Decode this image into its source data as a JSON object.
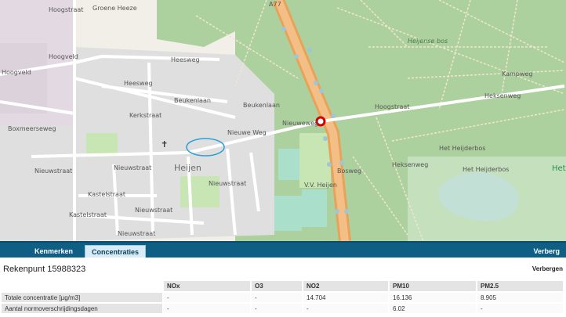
{
  "map": {
    "labels": {
      "hoogveld": "Hoogveld",
      "hoogveld2": "Hoogveld",
      "hoogstraat": "Hoogstraat",
      "groeneheeze": "Groene Heeze",
      "heesweg": "Heesweg",
      "heesweg2": "Heesweg",
      "boxmeerseweg": "Boxmeerseweg",
      "beukenlaan": "Beukenlaan",
      "beukenlaan2": "Beukenlaan",
      "nieuweweg": "Nieuweweg",
      "nieuwewegzuid": "Nieuwe Weg",
      "kerkstraat": "Kerkstraat",
      "nieuwstraat1": "Nieuwstraat",
      "nieuwstraat2": "Nieuwstraat",
      "nieuwstraat3": "Nieuwstraat",
      "nieuwstraat4": "Nieuwstraat",
      "nieuwstraat5": "Nieuwstraat",
      "kastelstraat": "Kastelstraat",
      "kastelstraat2": "Kastelstraat",
      "heijen": "Heijen",
      "vvheijen": "V.V. Heijen",
      "heijensebos": "Heijense bos",
      "kampweg": "Kampweg",
      "hoogstraat2": "Hoogstraat",
      "heksenweg": "Heksenweg",
      "heksenweg2": "Heksenweg",
      "hetheijderbos": "Het Heijderbos",
      "hetheijderbos2": "Het Heijderbos",
      "het": "Het",
      "a77": "A77",
      "bosweg": "Bosweg"
    }
  },
  "tabs": {
    "kenmerken": "Kenmerken",
    "concentraties": "Concentraties",
    "hide": "Verberg"
  },
  "panel": {
    "title": "Rekenpunt 15988323",
    "hide": "Verbergen",
    "columns": [
      "NOx",
      "O3",
      "NO2",
      "PM10",
      "PM2.5"
    ],
    "rows": [
      {
        "label": "Totale concentratie [µg/m3]",
        "values": [
          "-",
          "-",
          "14.704",
          "16.136",
          "8.905"
        ]
      },
      {
        "label": "Aantal normoverschrijdingsdagen",
        "values": [
          "-",
          "-",
          "-",
          "6.02",
          "-"
        ]
      }
    ]
  }
}
